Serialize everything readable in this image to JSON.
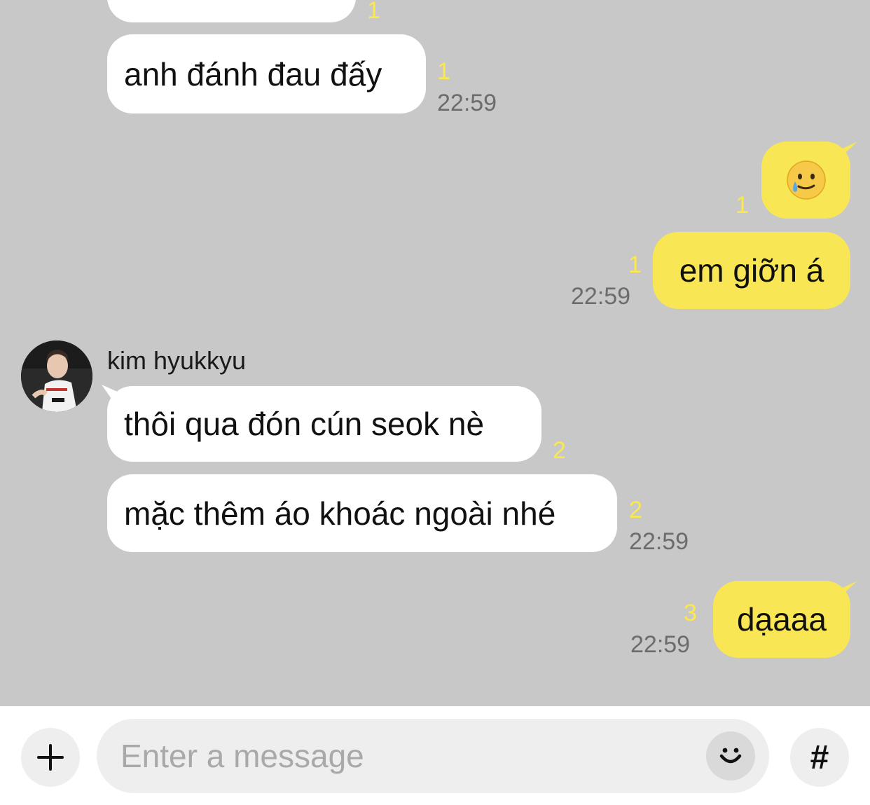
{
  "messages": [
    {
      "id": "m0",
      "side": "in",
      "text": "",
      "unread": "1",
      "time": ""
    },
    {
      "id": "m1",
      "side": "in",
      "text": "anh đánh đau đấy",
      "unread": "1",
      "time": "22:59"
    },
    {
      "id": "m2",
      "side": "out",
      "text": "🥲",
      "unread": "1",
      "time": ""
    },
    {
      "id": "m3",
      "side": "out",
      "text": "em giỡn á",
      "unread": "1",
      "time": "22:59"
    },
    {
      "id": "m4",
      "side": "in",
      "sender": "kim hyukkyu",
      "text": "thôi qua đón cún seok nè",
      "unread": "2",
      "time": ""
    },
    {
      "id": "m5",
      "side": "in",
      "text": "mặc thêm áo khoác ngoài nhé",
      "unread": "2",
      "time": "22:59"
    },
    {
      "id": "m6",
      "side": "out",
      "text": "dạaaa",
      "unread": "3",
      "time": "22:59"
    }
  ],
  "composer": {
    "placeholder": "Enter a message",
    "plus_icon": "plus-icon",
    "emoji_icon": "smiley-icon",
    "hashtag_label": "#"
  },
  "colors": {
    "chat_background": "#c8c8c8",
    "incoming_bubble": "#ffffff",
    "outgoing_bubble": "#f9e654",
    "unread_count": "#fbe94a",
    "timestamp": "#6c6c6c"
  }
}
